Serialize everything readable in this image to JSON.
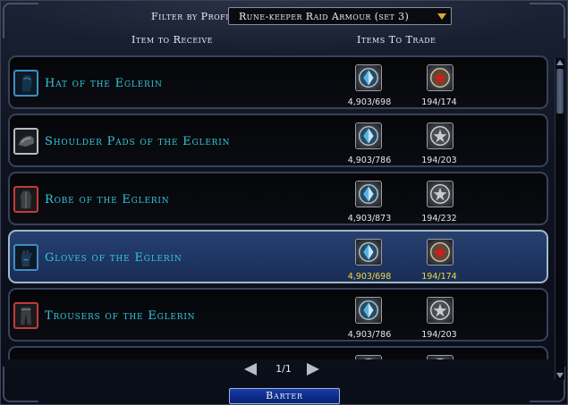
{
  "filter": {
    "label": "Filter by Profile:",
    "selected": "Rune-keeper Raid Armour (set 3)"
  },
  "columns": {
    "receive": "Item to Receive",
    "trade": "Items To Trade"
  },
  "rows": [
    {
      "name": "Hat of the Eglerin",
      "cost1": "4,903/698",
      "cost2": "194/174",
      "token2": "red-medallion-icon",
      "icon_border": "#3d8ec4",
      "selected": false
    },
    {
      "name": "Shoulder Pads of the Eglerin",
      "cost1": "4,903/786",
      "cost2": "194/203",
      "token2": "silver-medallion-icon",
      "icon_border": "#b9bcc2",
      "selected": false
    },
    {
      "name": "Robe of the Eglerin",
      "cost1": "4,903/873",
      "cost2": "194/232",
      "token2": "silver-medallion-icon",
      "icon_border": "#c33b3b",
      "selected": false
    },
    {
      "name": "Gloves of the Eglerin",
      "cost1": "4,903/698",
      "cost2": "194/174",
      "token2": "red-medallion-icon",
      "icon_border": "#3d8ec4",
      "selected": true
    },
    {
      "name": "Trousers of the Eglerin",
      "cost1": "4,903/786",
      "cost2": "194/203",
      "token2": "silver-medallion-icon",
      "icon_border": "#c33b3b",
      "selected": false
    }
  ],
  "pagination": {
    "page": "1/1"
  },
  "barter_label": "Barter",
  "colors": {
    "item_name": "#32c6dc",
    "selected_count": "#f0dc3c",
    "selected_row": "#1f3664"
  }
}
